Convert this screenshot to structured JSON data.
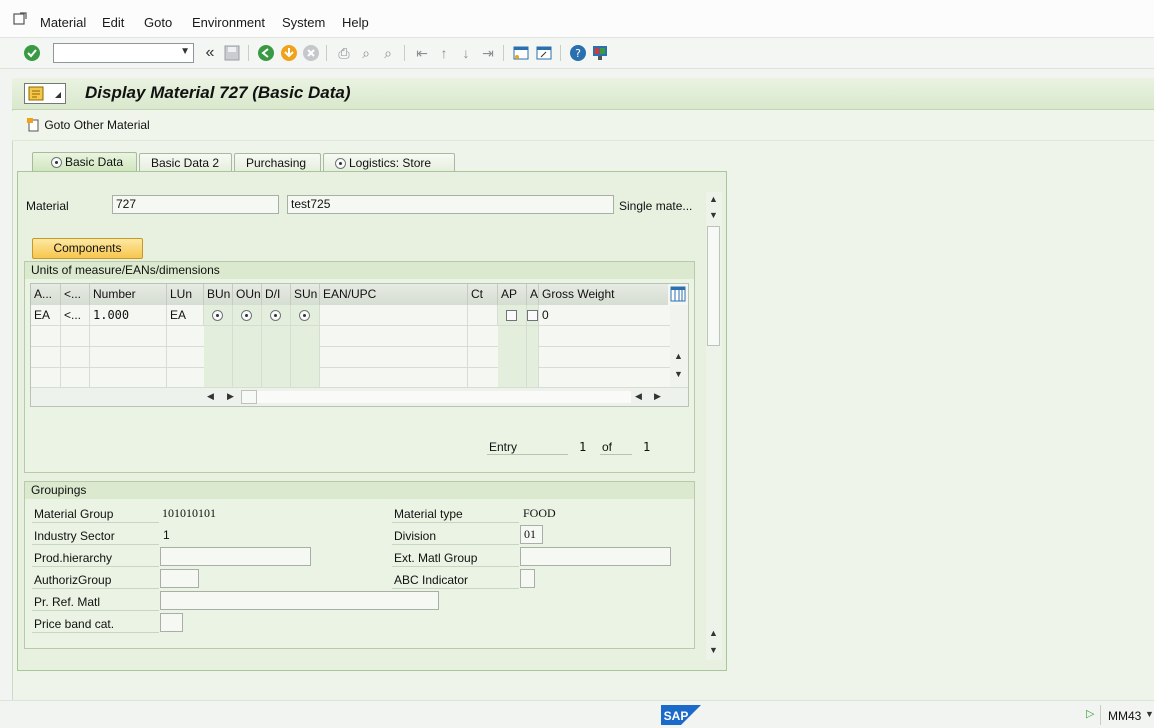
{
  "menu": [
    "Material",
    "Edit",
    "Goto",
    "Environment",
    "System",
    "Help"
  ],
  "toolbar": {
    "command_field_value": "",
    "icons": [
      "enter-icon",
      "back-double-icon",
      "save-icon",
      "back-icon",
      "exit-icon",
      "cancel-icon",
      "print-icon",
      "find-icon",
      "find-next-icon",
      "first-page-icon",
      "previous-page-icon",
      "next-page-icon",
      "last-page-icon",
      "create-session-icon",
      "shortcut-icon",
      "help-icon",
      "customize-layout-icon"
    ]
  },
  "title": "Display Material 727 (Basic Data)",
  "app_toolbar": {
    "goto_other_material": "Goto Other Material"
  },
  "tabs": [
    {
      "label": "Basic Data",
      "active": true
    },
    {
      "label": "Basic Data 2",
      "active": false
    },
    {
      "label": "Purchasing",
      "active": false
    },
    {
      "label": "Logistics: Store",
      "active": false
    }
  ],
  "material": {
    "label": "Material",
    "number": "727",
    "description": "test725",
    "type_text": "Single mate..."
  },
  "components_button": "Components",
  "uom_group": {
    "title": "Units of measure/EANs/dimensions",
    "columns": [
      "A...",
      "<...",
      "Number",
      "LUn",
      "BUn",
      "OUn",
      "D/I",
      "SUn",
      "EAN/UPC",
      "Ct",
      "AP",
      "A",
      "Gross Weight"
    ],
    "rows": [
      {
        "a": "EA",
        "b": "<...",
        "number": "1.000",
        "lun": "EA",
        "gross_weight": "0"
      }
    ],
    "entry_label": "Entry",
    "entry_current": "1",
    "entry_of": "of",
    "entry_total": "1"
  },
  "groupings": {
    "title": "Groupings",
    "material_group_label": "Material Group",
    "material_group": "101010101",
    "industry_sector_label": "Industry Sector",
    "industry_sector": "1",
    "prod_hierarchy_label": "Prod.hierarchy",
    "prod_hierarchy": "",
    "authoriz_group_label": "AuthorizGroup",
    "authoriz_group": "",
    "pr_ref_matl_label": "Pr. Ref. Matl",
    "pr_ref_matl": "",
    "price_band_label": "Price band cat.",
    "price_band": "",
    "material_type_label": "Material type",
    "material_type": "FOOD",
    "division_label": "Division",
    "division": "01",
    "ext_matl_group_label": "Ext. Matl Group",
    "ext_matl_group": "",
    "abc_indicator_label": "ABC Indicator",
    "abc_indicator": ""
  },
  "status": {
    "brand": "SAP",
    "transaction": "MM43"
  },
  "colors": {
    "accent_green": "#2e8b3a",
    "button_yellow": "#f7c64d",
    "sap_blue": "#1b6ac9"
  }
}
